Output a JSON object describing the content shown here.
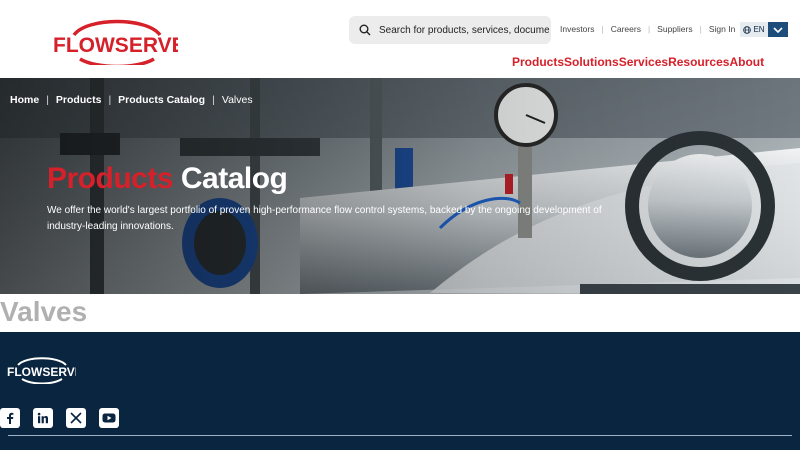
{
  "header": {
    "logo_text": "FLOWSERVE",
    "search": {
      "placeholder": "Search for products, services, documents..."
    },
    "utility_links": [
      "Investors",
      "Careers",
      "Suppliers",
      "Sign In"
    ],
    "language": "EN",
    "main_nav": [
      "Products",
      "Solutions",
      "Services",
      "Resources",
      "About"
    ]
  },
  "hero": {
    "breadcrumb": [
      "Home",
      "Products",
      "Products Catalog",
      "Valves"
    ],
    "title_red": "Products",
    "title_white": "Catalog",
    "description": "We offer the world's largest portfolio of proven high-performance flow control systems, backed by the ongoing development of industry-leading innovations."
  },
  "section": {
    "title": "Valves"
  },
  "footer": {
    "logo_text": "FLOWSERVE",
    "social": [
      "facebook-icon",
      "linkedin-icon",
      "x-icon",
      "youtube-icon"
    ]
  },
  "colors": {
    "brand_red": "#d6202a",
    "navy": "#0a2540",
    "nav_button": "#1d4e7a"
  }
}
